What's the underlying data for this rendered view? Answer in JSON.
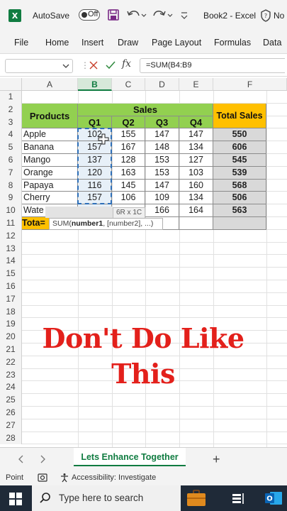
{
  "titlebar": {
    "autosave_label": "AutoSave",
    "toggle_state": "Off",
    "doc_title": "Book2 - Excel",
    "extra": "No"
  },
  "ribbon": {
    "tabs": [
      "File",
      "Home",
      "Insert",
      "Draw",
      "Page Layout",
      "Formulas",
      "Data"
    ]
  },
  "formula_bar": {
    "name_box": "",
    "fx": "fx",
    "formula": "=SUM(B4:B9"
  },
  "grid": {
    "columns": [
      "A",
      "B",
      "C",
      "D",
      "E",
      "F"
    ],
    "selected_column": "B",
    "rows": [
      "1",
      "2",
      "3",
      "4",
      "5",
      "6",
      "7",
      "8",
      "9",
      "10",
      "11",
      "12",
      "13",
      "14",
      "15",
      "16",
      "17",
      "18",
      "19",
      "20",
      "21",
      "22",
      "23",
      "24",
      "25",
      "26",
      "27",
      "28"
    ]
  },
  "table": {
    "products_header": "Products",
    "sales_header": "Sales",
    "total_sales_header": "Total Sales",
    "quarters": [
      "Q1",
      "Q2",
      "Q3",
      "Q4"
    ],
    "data": [
      {
        "product": "Apple",
        "q1": "102",
        "q2": "155",
        "q3": "147",
        "q4": "147",
        "total": "550"
      },
      {
        "product": "Banana",
        "q1": "157",
        "q2": "167",
        "q3": "148",
        "q4": "134",
        "total": "606"
      },
      {
        "product": "Mango",
        "q1": "137",
        "q2": "128",
        "q3": "153",
        "q4": "127",
        "total": "545"
      },
      {
        "product": "Orange",
        "q1": "120",
        "q2": "163",
        "q3": "153",
        "q4": "103",
        "total": "539"
      },
      {
        "product": "Papaya",
        "q1": "116",
        "q2": "145",
        "q3": "147",
        "q4": "160",
        "total": "568"
      },
      {
        "product": "Cherry",
        "q1": "157",
        "q2": "106",
        "q3": "109",
        "q4": "134",
        "total": "506"
      },
      {
        "product": "Wate",
        "q1": "",
        "q2": "",
        "q3": "166",
        "q4": "164",
        "total": "563"
      }
    ],
    "total_row_label": "Tota="
  },
  "overlays": {
    "size_badge": "6R x 1C",
    "tooltip_fn": "SUM(",
    "tooltip_arg1": "number1",
    "tooltip_rest": ", [number2], ...)",
    "banner": "Don't Do Like This"
  },
  "sheets": {
    "active": "Lets Enhance Together",
    "add": "+"
  },
  "status": {
    "mode": "Point",
    "accessibility": "Accessibility: Investigate"
  },
  "taskbar": {
    "search_placeholder": "Type here to search"
  },
  "colors": {
    "excel_green": "#107c41",
    "header_green": "#92d050",
    "header_gold": "#ffc000",
    "total_gray": "#d9d9d9",
    "banner_red": "#e3201b",
    "taskbar": "#1f2a38"
  }
}
